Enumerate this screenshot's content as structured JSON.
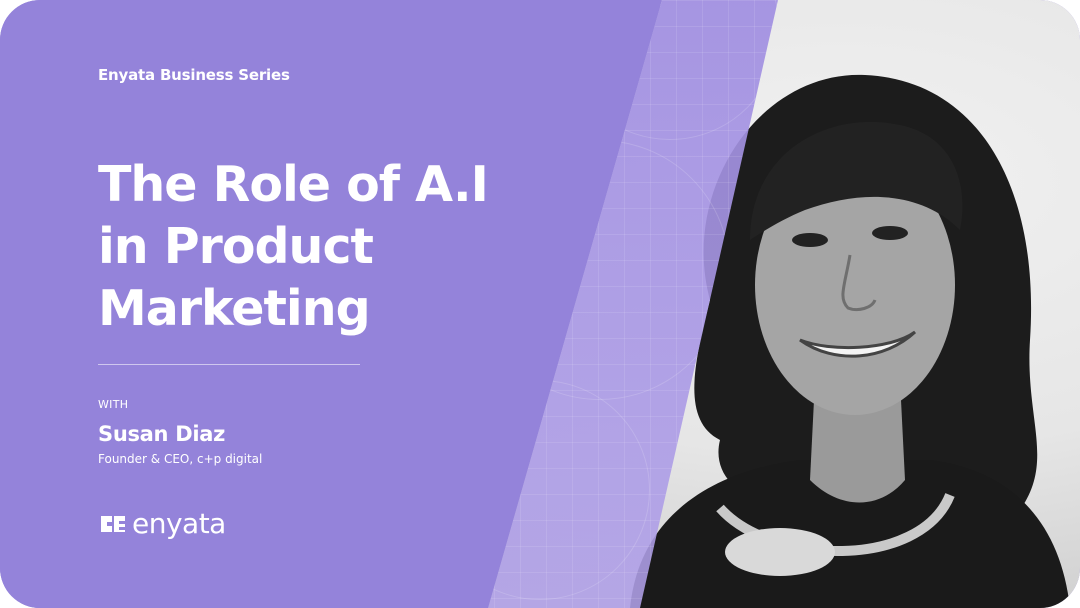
{
  "series_label": "Enyata Business Series",
  "title_lines": [
    "The Role of A.I",
    "in Product",
    "Marketing"
  ],
  "with_label": "WITH",
  "speaker": {
    "name": "Susan Diaz",
    "role": "Founder & CEO, c+p digital"
  },
  "brand": {
    "logo_text": "enyata",
    "logo_icon": "enyata-logo-icon"
  },
  "colors": {
    "primary_purple": "#9483da",
    "text": "#ffffff"
  }
}
